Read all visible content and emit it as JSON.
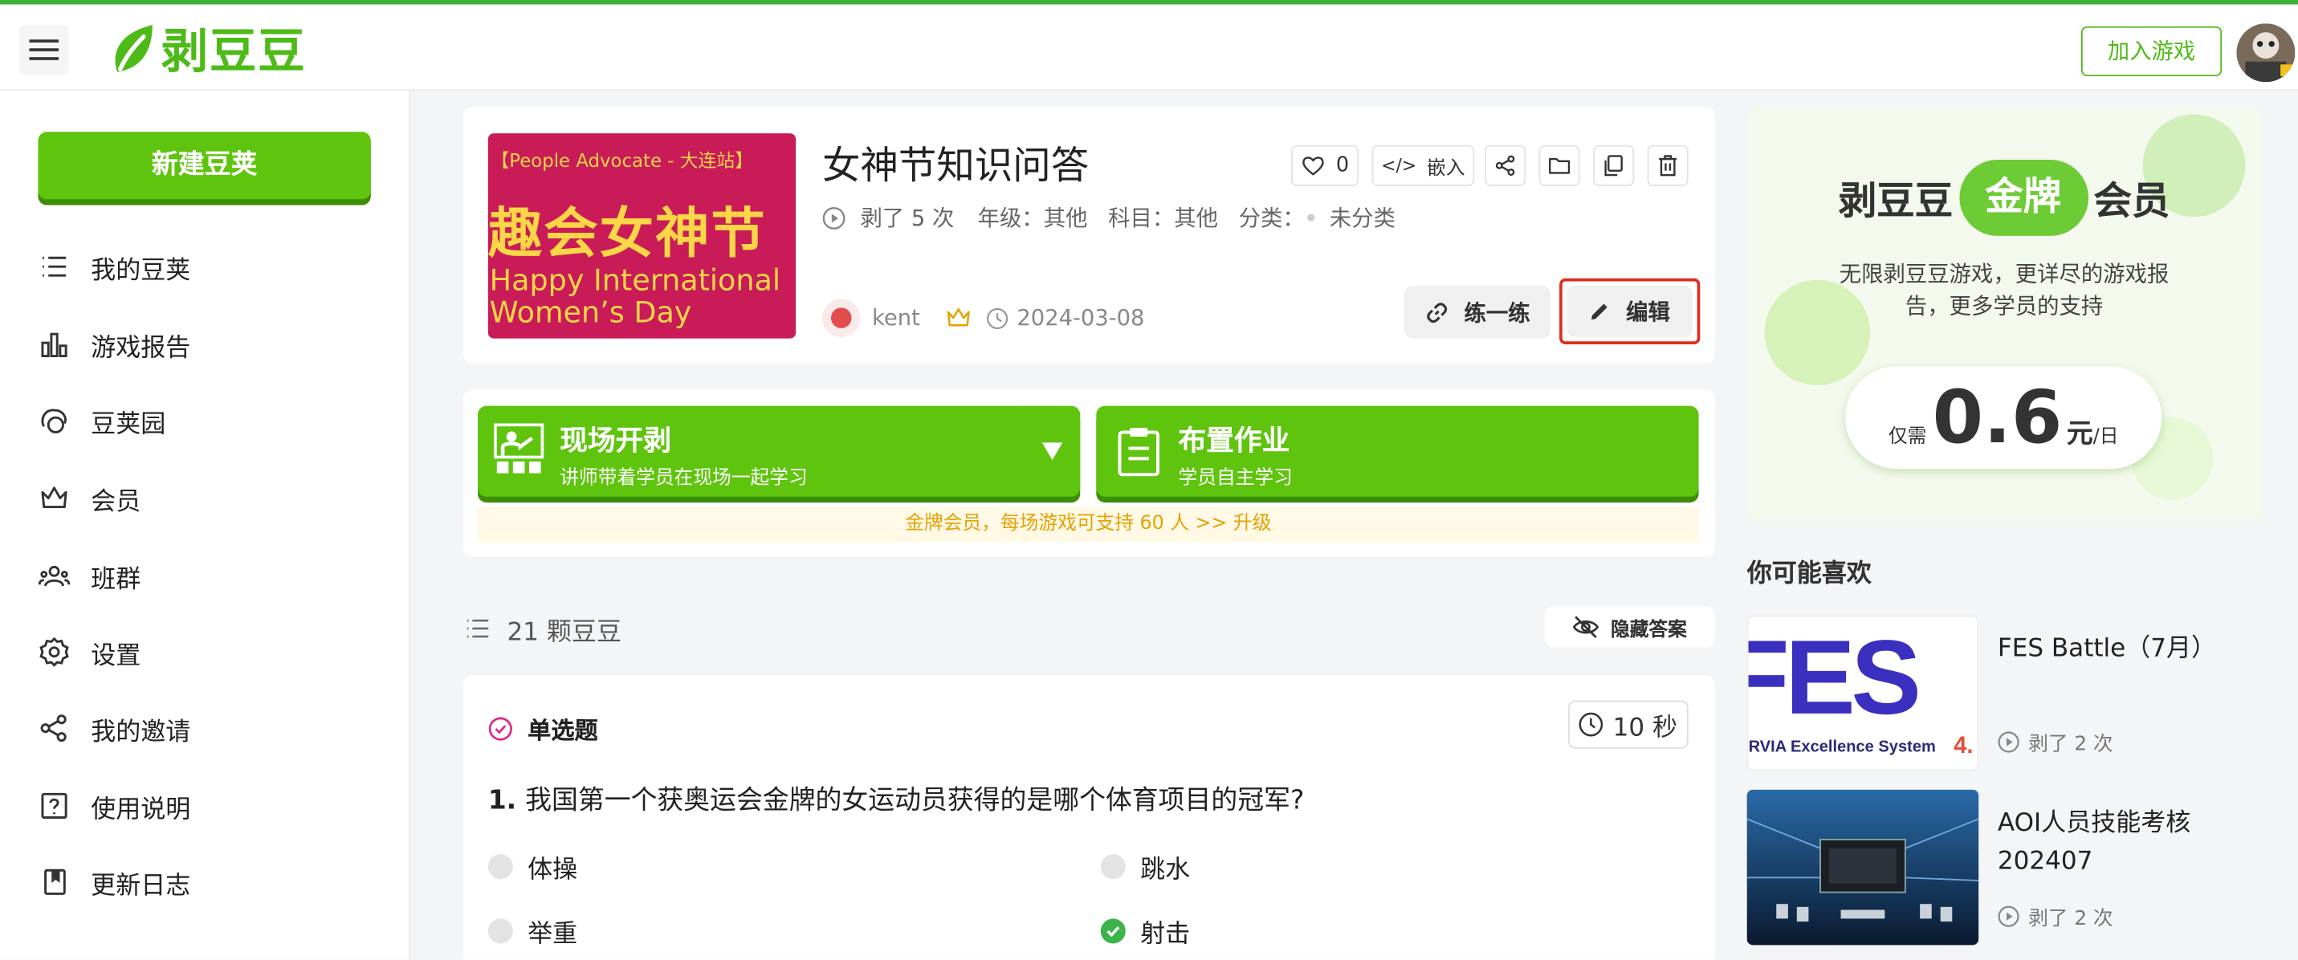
{
  "brand": {
    "name": "剥豆豆",
    "accent": "#5fc40e"
  },
  "header": {
    "join_label": "加入游戏"
  },
  "sidebar": {
    "new_label": "新建豆荚",
    "items": [
      {
        "label": "我的豆荚",
        "icon": "list-icon"
      },
      {
        "label": "游戏报告",
        "icon": "bar-chart-icon"
      },
      {
        "label": "豆荚园",
        "icon": "garden-icon"
      },
      {
        "label": "会员",
        "icon": "crown-icon"
      },
      {
        "label": "班群",
        "icon": "group-icon"
      },
      {
        "label": "设置",
        "icon": "gear-icon"
      },
      {
        "label": "我的邀请",
        "icon": "share-icon"
      },
      {
        "label": "使用说明",
        "icon": "help-icon"
      },
      {
        "label": "更新日志",
        "icon": "book-icon"
      }
    ]
  },
  "game": {
    "cover": {
      "line1": "【People Advocate - 大连站】",
      "line2": "趣会女神节",
      "line3": "Happy International",
      "line4": "Women’s Day"
    },
    "title": "女神节知识问答",
    "plays": "剥了 5 次",
    "grade": "年级：其他",
    "subject": "科目：其他",
    "category_label": "分类：",
    "category": "未分类",
    "likes": "0",
    "embed_label": "嵌入",
    "embed_glyph": "</>",
    "author": "kent",
    "date": "2024-03-08",
    "practice_label": "练一练",
    "edit_label": "编辑"
  },
  "actions": {
    "live": {
      "title": "现场开剥",
      "subtitle": "讲师带着学员在现场一起学习"
    },
    "homework": {
      "title": "布置作业",
      "subtitle": "学员自主学习"
    },
    "promo": "金牌会员，每场游戏可支持 60 人  >>  升级"
  },
  "question_list": {
    "count_label": "21 颗豆豆",
    "hide_label": "隐藏答案"
  },
  "question": {
    "type": "单选题",
    "timer": "10 秒",
    "number": "1.",
    "text": "我国第一个获奥运会金牌的女运动员获得的是哪个体育项目的冠军?",
    "options": [
      {
        "label": "体操",
        "correct": false
      },
      {
        "label": "跳水",
        "correct": false
      },
      {
        "label": "举重",
        "correct": false
      },
      {
        "label": "射击",
        "correct": true
      }
    ]
  },
  "membership": {
    "title_pre": "剥豆豆",
    "badge": "金牌",
    "title_post": "会员",
    "desc": "无限剥豆豆游戏，更详尽的游戏报告，更多学员的支持",
    "price_prefix": "仅需",
    "price": "0.6",
    "price_unit": "元",
    "price_per": "/日"
  },
  "recommend": {
    "title": "你可能喜欢",
    "items": [
      {
        "name": "FES Battle（7月）",
        "plays": "剥了 2 次",
        "thumb_big": "FES",
        "thumb_small": "RVIA  Excellence System",
        "thumb_tail": "4."
      },
      {
        "name": "AOI人员技能考核202407",
        "plays": "剥了 2 次"
      }
    ]
  }
}
